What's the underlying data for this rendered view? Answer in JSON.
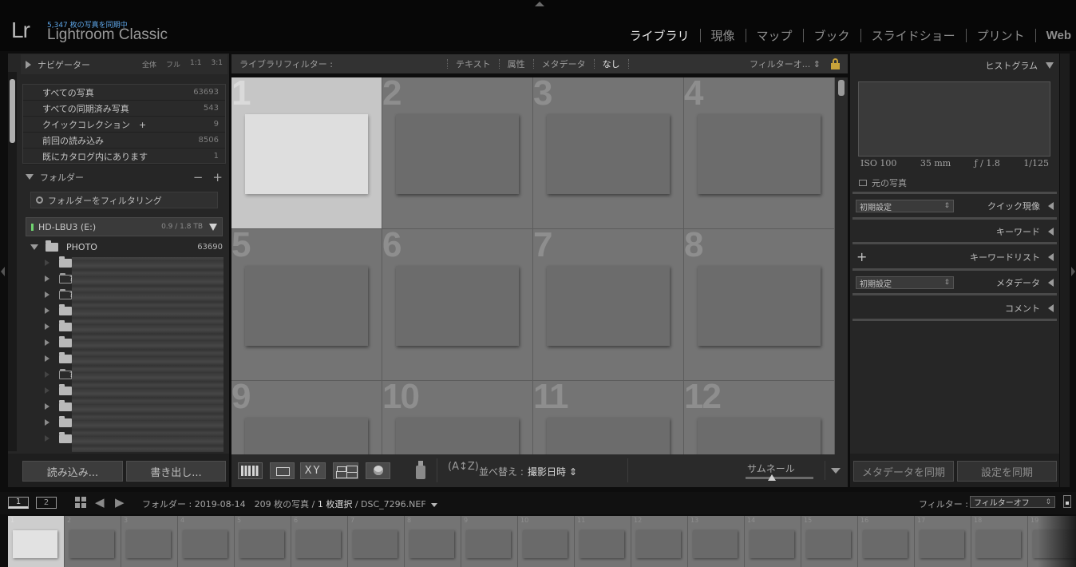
{
  "identity": {
    "logo": "Lr",
    "sync_status": "5,347 枚の写真を同期中",
    "app_name": "Lightroom Classic"
  },
  "modules": [
    "ライブラリ",
    "現像",
    "マップ",
    "ブック",
    "スライドショー",
    "プリント",
    "Web"
  ],
  "active_module": "ライブラリ",
  "navigator": {
    "title": "ナビゲーター",
    "zooms": [
      "全体",
      "フル",
      "1:1",
      "3:1"
    ]
  },
  "catalog": [
    {
      "label": "すべての写真",
      "count": "63693"
    },
    {
      "label": "すべての同期済み写真",
      "count": "543"
    },
    {
      "label": "クイックコレクション　+",
      "count": "9"
    },
    {
      "label": "前回の読み込み",
      "count": "8506"
    },
    {
      "label": "既にカタログ内にあります",
      "count": "1"
    }
  ],
  "folders": {
    "title": "フォルダー",
    "minus": "−",
    "plus": "+",
    "filter_placeholder": "フォルダーをフィルタリング",
    "volume": {
      "name": "HD-LBU3 (E:)",
      "size": "0.9 / 1.8 TB"
    },
    "root": {
      "name": "PHOTO",
      "count": "63690"
    }
  },
  "left_buttons": {
    "import": "読み込み...",
    "export": "書き出し..."
  },
  "filter_bar": {
    "title": "ライブラリフィルター :",
    "options": [
      "テキスト",
      "属性",
      "メタデータ",
      "なし"
    ],
    "active": "なし",
    "preset": "フィルターオ... ⇕"
  },
  "grid": {
    "cell_numbers": [
      "1",
      "2",
      "3",
      "4",
      "5",
      "6",
      "7",
      "8",
      "9",
      "10",
      "11",
      "12"
    ],
    "selected_index": 0
  },
  "toolbar": {
    "compare_label": "XY",
    "sort_icon": "(A↕Z)",
    "sort_label": "並べ替え :",
    "sort_value": "撮影日時 ⇕",
    "thumbnail_label": "サムネール"
  },
  "right_panel": {
    "histogram_title": "ヒストグラム",
    "exif": {
      "iso": "ISO 100",
      "focal": "35 mm",
      "aperture": "ƒ / 1.8",
      "shutter": "1/125"
    },
    "original_photo": "元の写真",
    "quick_develop": "クイック現像",
    "preset_value": "初期設定",
    "keywording": "キーワード",
    "keyword_list": "キーワードリスト",
    "metadata": "メタデータ",
    "comments": "コメント",
    "sync_metadata": "メタデータを同期",
    "sync_settings": "設定を同期"
  },
  "film_bar": {
    "monitor1": "1",
    "monitor2": "2",
    "source_prefix": "フォルダー : 2019-08-14　209 枚の写真 / ",
    "source_selected": "1 枚選択",
    "source_file": " / DSC_7296.NEF",
    "filter_label": "フィルター :",
    "filter_value": "フィルターオフ"
  },
  "filmstrip": {
    "numbers": [
      "1",
      "2",
      "3",
      "4",
      "5",
      "6",
      "7",
      "8",
      "9",
      "10",
      "11",
      "12",
      "13",
      "14",
      "15",
      "16",
      "17",
      "18",
      "19"
    ],
    "selected_index": 0
  },
  "colors": {
    "accent_sync": "#5ea6e8",
    "lock": "#c8a23a",
    "selected_cell": "#c6c6c6"
  }
}
